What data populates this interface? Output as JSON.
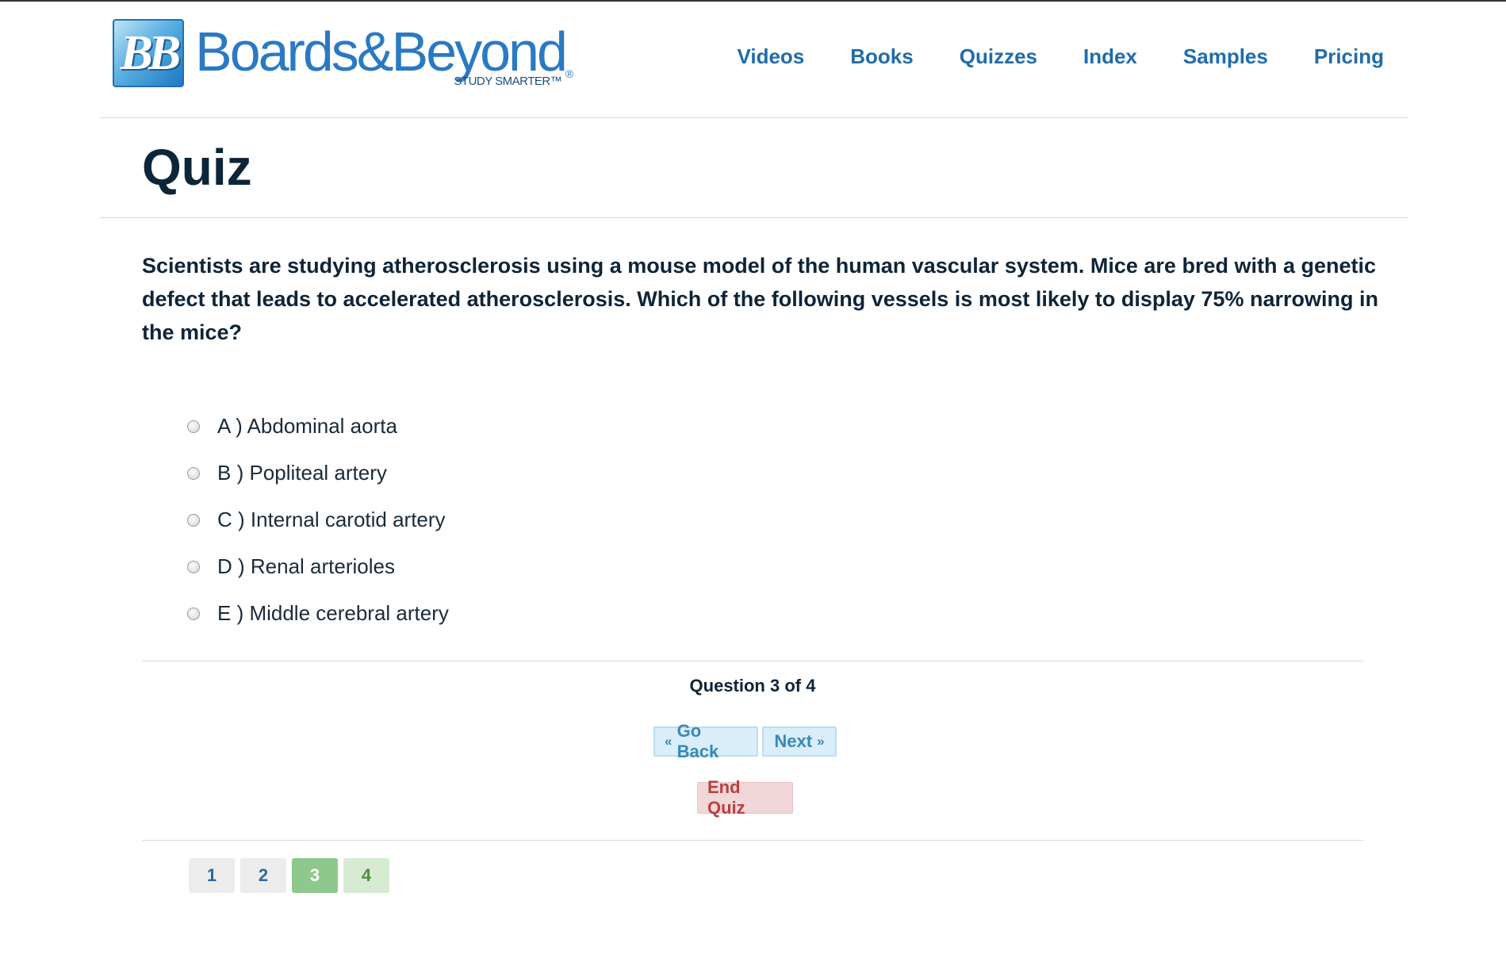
{
  "header": {
    "logo_mark": "BB",
    "brand_name": "Boards&Beyond",
    "brand_reg": "®",
    "tagline": "STUDY SMARTER™",
    "nav": [
      "Videos",
      "Books",
      "Quizzes",
      "Index",
      "Samples",
      "Pricing"
    ]
  },
  "page": {
    "title": "Quiz"
  },
  "quiz": {
    "question": "Scientists are studying atherosclerosis using a mouse model of the human vascular system. Mice are bred with a genetic defect that leads to accelerated atherosclerosis. Which of the following vessels is most likely to display 75% narrowing in the mice?",
    "options": [
      "A ) Abdominal aorta",
      "B ) Popliteal artery",
      "C ) Internal carotid artery",
      "D ) Renal arterioles",
      "E ) Middle cerebral artery"
    ],
    "status": "Question 3 of 4",
    "back_label": "Go Back",
    "back_prefix": "«",
    "next_label": "Next",
    "next_suffix": "»",
    "end_label": "End Quiz",
    "pages": [
      "1",
      "2",
      "3",
      "4"
    ],
    "current_page": 3
  },
  "colors": {
    "brand": "#2a79c4",
    "nav": "#1f6cac",
    "title": "#0d2538",
    "current_page": "#8fc88c",
    "end_quiz": "#b8413f"
  }
}
